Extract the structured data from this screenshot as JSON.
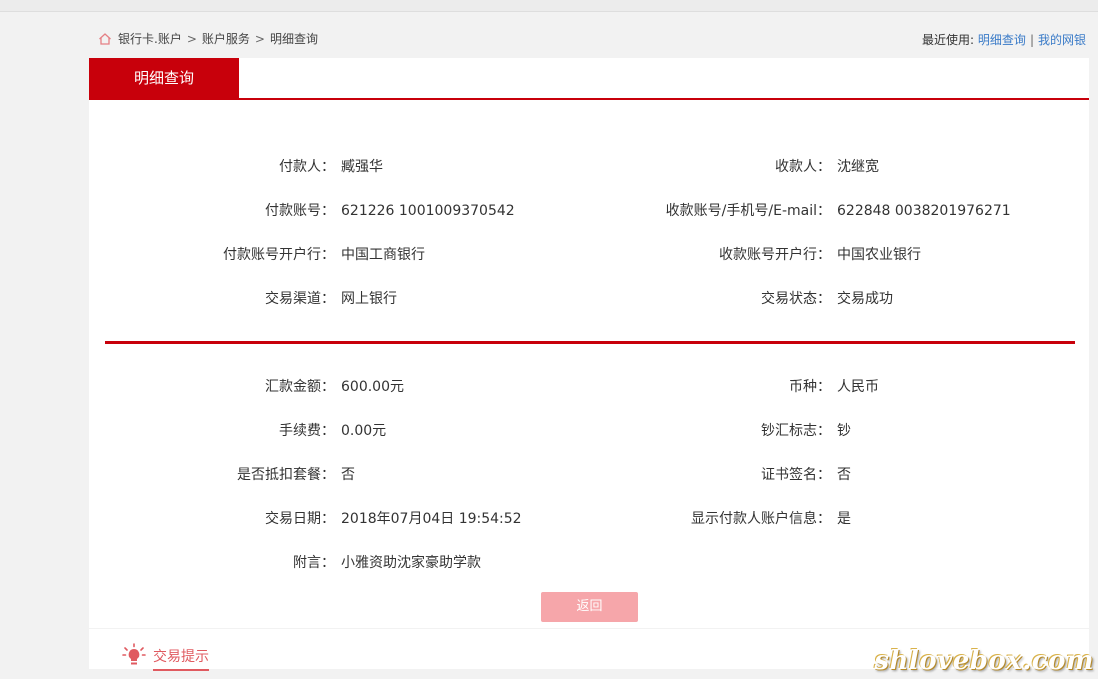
{
  "breadcrumb": {
    "items": [
      "银行卡.账户",
      "账户服务",
      "明细查询"
    ],
    "sep": ">"
  },
  "recent": {
    "label": "最近使用:",
    "links": [
      "明细查询",
      "我的网银"
    ],
    "sep": "|"
  },
  "tab": {
    "title": "明细查询"
  },
  "section1": {
    "left": [
      {
        "label": "付款人：",
        "value": "臧强华"
      },
      {
        "label": "付款账号：",
        "value": "621226 1001009370542"
      },
      {
        "label": "付款账号开户行：",
        "value": "中国工商银行"
      },
      {
        "label": "交易渠道：",
        "value": "网上银行"
      }
    ],
    "right": [
      {
        "label": "收款人：",
        "value": "沈继宽"
      },
      {
        "label": "收款账号/手机号/E-mail：",
        "value": "622848 0038201976271"
      },
      {
        "label": "收款账号开户行：",
        "value": "中国农业银行"
      },
      {
        "label": "交易状态：",
        "value": "交易成功"
      }
    ]
  },
  "section2": {
    "left": [
      {
        "label": "汇款金额：",
        "value": "600.00元"
      },
      {
        "label": "手续费：",
        "value": "0.00元"
      },
      {
        "label": "是否抵扣套餐：",
        "value": "否"
      },
      {
        "label": "交易日期：",
        "value": "2018年07月04日 19:54:52"
      },
      {
        "label": "附言：",
        "value": "小雅资助沈家豪助学款"
      }
    ],
    "right": [
      {
        "label": "币种：",
        "value": "人民币"
      },
      {
        "label": "钞汇标志：",
        "value": "钞"
      },
      {
        "label": "证书签名：",
        "value": "否"
      },
      {
        "label": "显示付款人账户信息：",
        "value": "是"
      }
    ]
  },
  "buttons": {
    "back": "返回"
  },
  "tips": {
    "title": "交易提示"
  },
  "watermark": "shlovebox.com",
  "colors": {
    "brand_red": "#c8000b",
    "link_blue": "#3a7bc8",
    "button_pink": "#f6a6aa"
  }
}
